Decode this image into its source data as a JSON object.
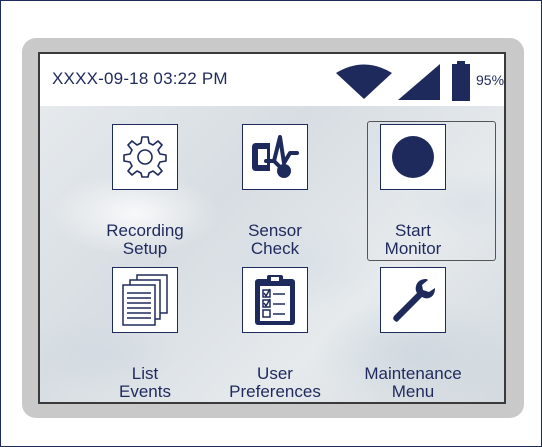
{
  "status": {
    "datetime": "XXXX-09-18 03:22 PM",
    "battery_percent": "95%",
    "wifi_icon": "wifi-icon",
    "signal_icon": "signal-strength-icon",
    "battery_icon": "battery-icon"
  },
  "menu": {
    "items": [
      {
        "line1": "Recording",
        "line2": "Setup",
        "icon": "gear-icon"
      },
      {
        "line1": "Sensor",
        "line2": "Check",
        "icon": "sensor-check-icon"
      },
      {
        "line1": "Start",
        "line2": "Monitor",
        "icon": "record-circle-icon"
      },
      {
        "line1": "List",
        "line2": "Events",
        "icon": "documents-icon"
      },
      {
        "line1": "User",
        "line2": "Preferences",
        "icon": "clipboard-checklist-icon"
      },
      {
        "line1": "Maintenance",
        "line2": "Menu",
        "icon": "wrench-icon"
      }
    ],
    "selected": "Start Monitor"
  },
  "colors": {
    "primary": "#1f2a5c",
    "bezel": "#c9c9c9"
  }
}
